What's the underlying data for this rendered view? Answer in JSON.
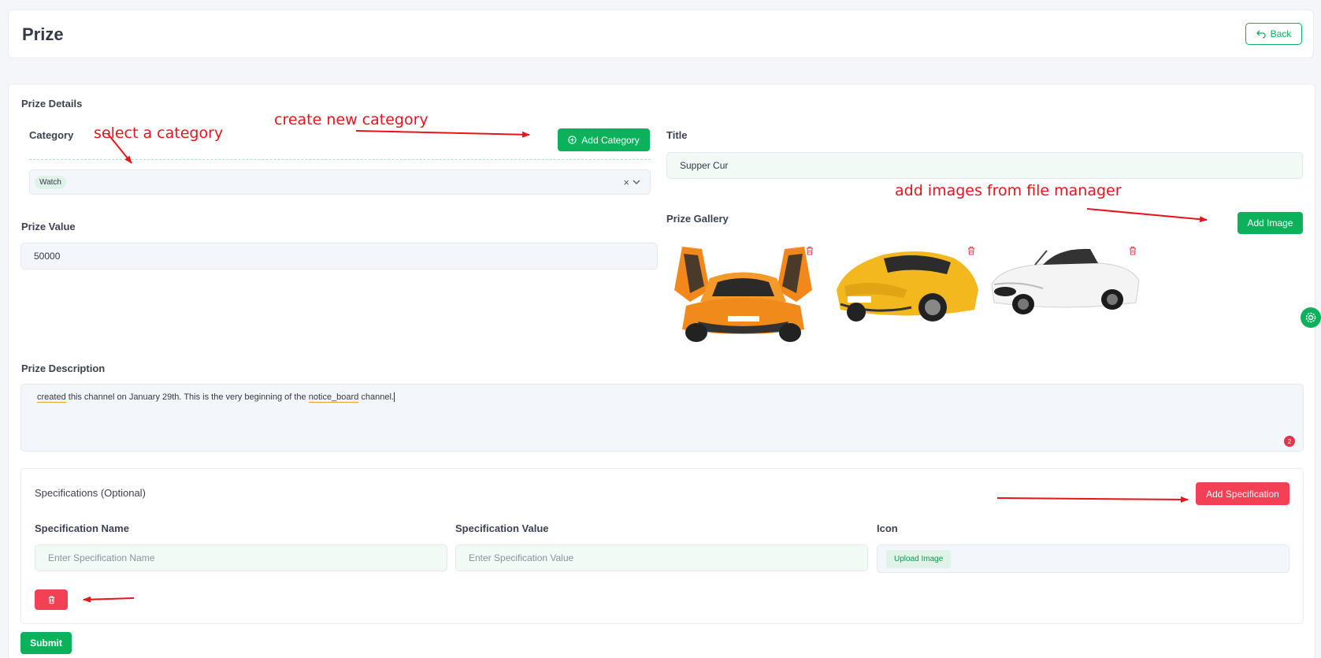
{
  "header": {
    "title": "Prize",
    "back_label": "Back"
  },
  "details": {
    "section_title": "Prize Details",
    "category_label": "Category",
    "category_selected": "Watch",
    "add_category_label": "Add Category",
    "title_label": "Title",
    "title_value": "Supper Cur",
    "prize_value_label": "Prize Value",
    "prize_value": "50000",
    "gallery_label": "Prize Gallery",
    "add_image_label": "Add Image",
    "gallery_images": [
      "orange-supercar-image",
      "yellow-sports-car-image",
      "white-convertible-image"
    ]
  },
  "description": {
    "label": "Prize Description",
    "word1": "created",
    "middle": " this channel on January 29th. This is the very beginning of the ",
    "word2": "notice_board",
    "end": " channel.",
    "badge_count": "2"
  },
  "specifications": {
    "title": "Specifications (Optional)",
    "add_label": "Add Specification",
    "name_label": "Specification Name",
    "name_placeholder": "Enter Specification Name",
    "value_label": "Specification Value",
    "value_placeholder": "Enter Specification Value",
    "icon_label": "Icon",
    "upload_label": "Upload Image"
  },
  "submit_label": "Submit",
  "annotations": {
    "select_category": "select a category",
    "create_category": "create new category",
    "add_images": "add images from file manager"
  },
  "colors": {
    "primary_green": "#0cb15c",
    "danger_red": "#f34054",
    "annotation_red": "#e8141c"
  }
}
